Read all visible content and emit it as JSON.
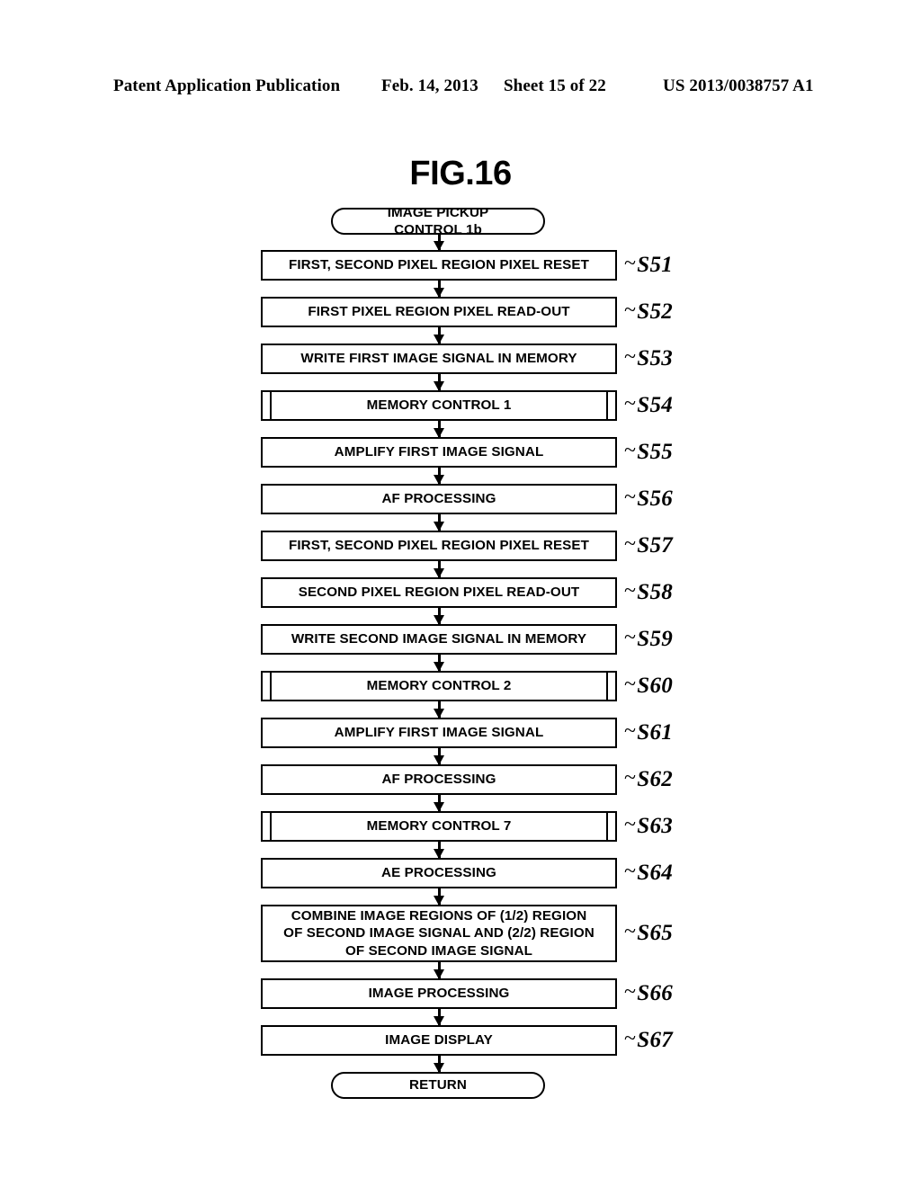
{
  "header": {
    "publication": "Patent Application Publication",
    "date": "Feb. 14, 2013",
    "sheet": "Sheet 15 of 22",
    "patent_number": "US 2013/0038757 A1"
  },
  "figure": {
    "title": "FIG.16"
  },
  "flowchart": {
    "start": {
      "label": "IMAGE PICKUP CONTROL 1b",
      "shape": "terminal"
    },
    "end": {
      "label": "RETURN",
      "shape": "terminal"
    },
    "steps": [
      {
        "ref": "S51",
        "label": "FIRST, SECOND PIXEL REGION PIXEL RESET",
        "shape": "process"
      },
      {
        "ref": "S52",
        "label": "FIRST PIXEL REGION PIXEL READ-OUT",
        "shape": "process"
      },
      {
        "ref": "S53",
        "label": "WRITE FIRST IMAGE SIGNAL IN MEMORY",
        "shape": "process"
      },
      {
        "ref": "S54",
        "label": "MEMORY CONTROL 1",
        "shape": "subroutine"
      },
      {
        "ref": "S55",
        "label": "AMPLIFY FIRST IMAGE SIGNAL",
        "shape": "process"
      },
      {
        "ref": "S56",
        "label": "AF PROCESSING",
        "shape": "process"
      },
      {
        "ref": "S57",
        "label": "FIRST, SECOND PIXEL REGION PIXEL RESET",
        "shape": "process"
      },
      {
        "ref": "S58",
        "label": "SECOND PIXEL REGION PIXEL READ-OUT",
        "shape": "process"
      },
      {
        "ref": "S59",
        "label": "WRITE SECOND IMAGE SIGNAL IN MEMORY",
        "shape": "process"
      },
      {
        "ref": "S60",
        "label": "MEMORY CONTROL 2",
        "shape": "subroutine"
      },
      {
        "ref": "S61",
        "label": "AMPLIFY FIRST IMAGE SIGNAL",
        "shape": "process"
      },
      {
        "ref": "S62",
        "label": "AF PROCESSING",
        "shape": "process"
      },
      {
        "ref": "S63",
        "label": "MEMORY CONTROL 7",
        "shape": "subroutine"
      },
      {
        "ref": "S64",
        "label": "AE PROCESSING",
        "shape": "process"
      },
      {
        "ref": "S65",
        "label": "COMBINE IMAGE REGIONS OF (1/2) REGION OF SECOND IMAGE SIGNAL AND (2/2) REGION OF SECOND IMAGE SIGNAL",
        "shape": "process"
      },
      {
        "ref": "S66",
        "label": "IMAGE PROCESSING",
        "shape": "process"
      },
      {
        "ref": "S67",
        "label": "IMAGE DISPLAY",
        "shape": "process"
      }
    ]
  }
}
